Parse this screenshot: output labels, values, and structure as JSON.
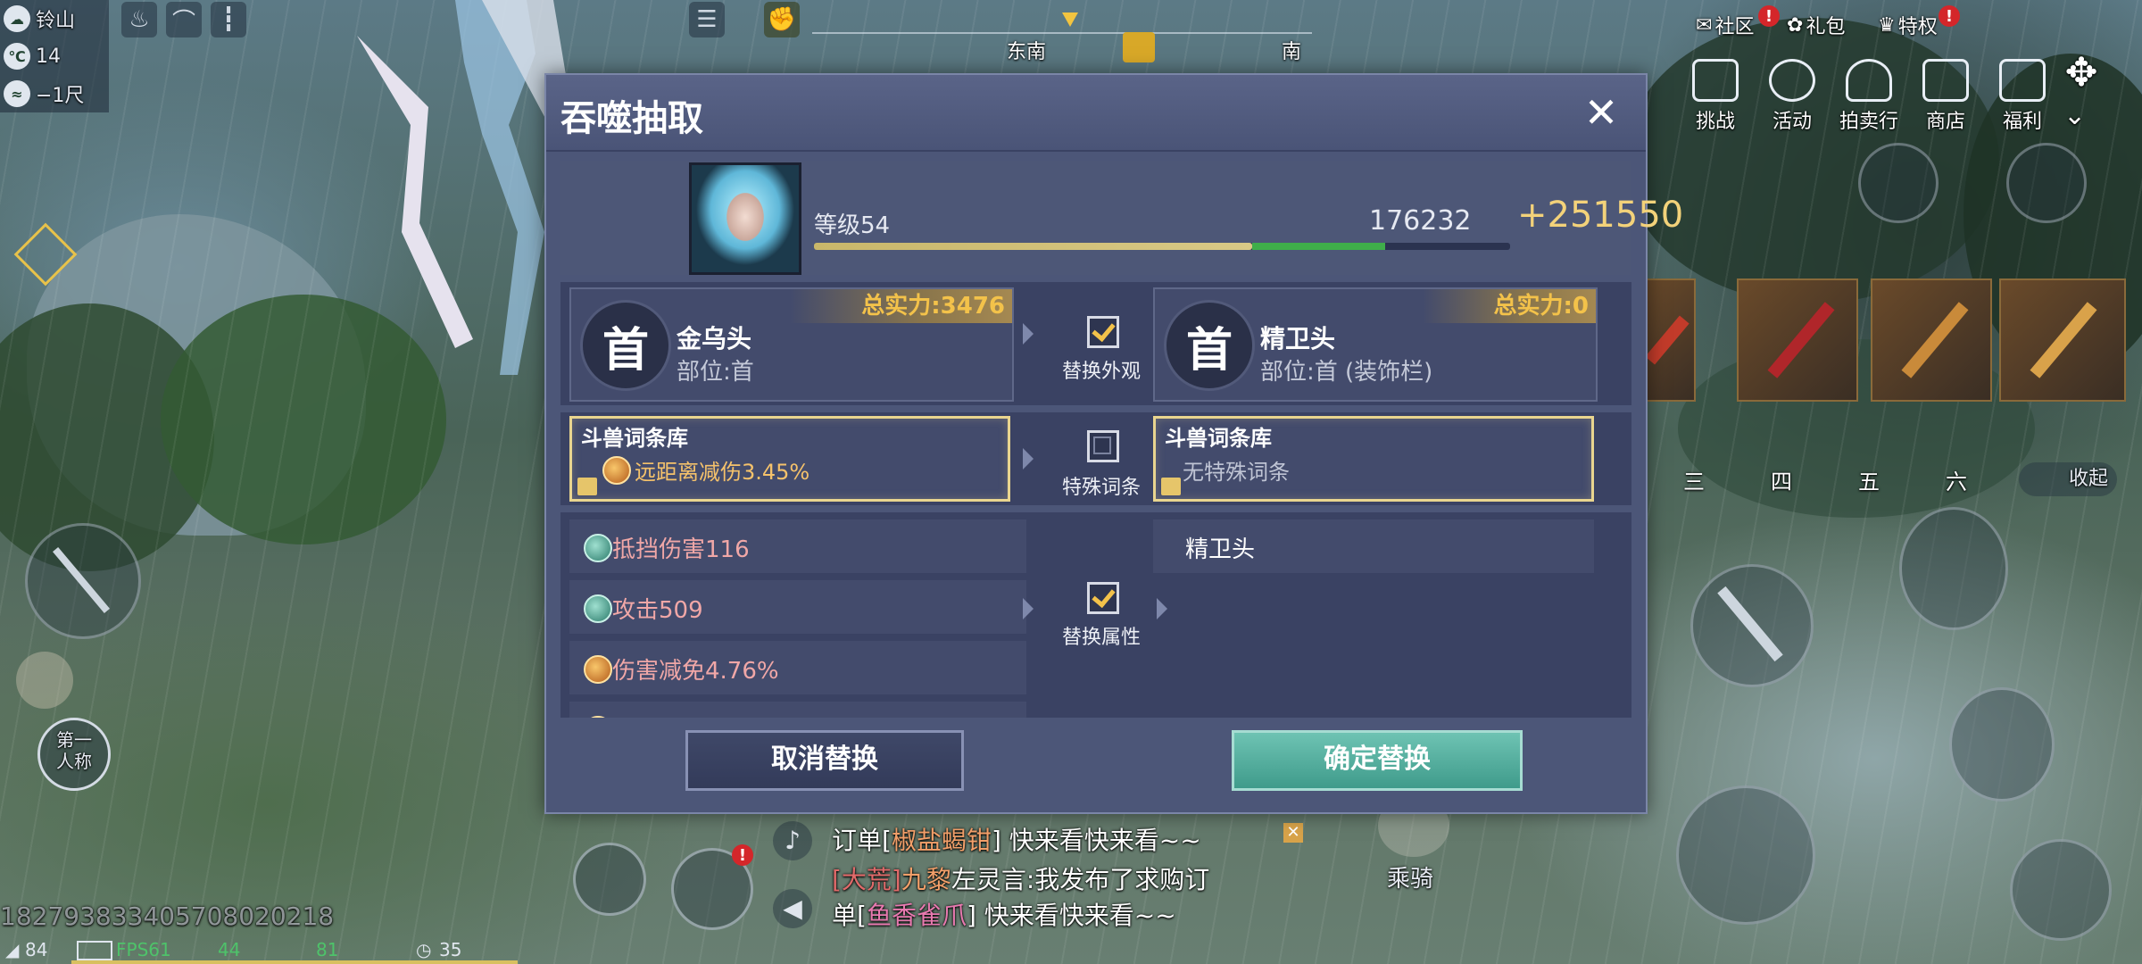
{
  "status": {
    "location": "铃山",
    "temperature": "14",
    "water_depth": "−1尺"
  },
  "compass": {
    "dir_left": "东南",
    "dir_right": "南"
  },
  "top_right": {
    "community": "社区",
    "gift": "礼包",
    "privilege": "特权",
    "badge": "!",
    "menu": [
      "挑战",
      "活动",
      "拍卖行",
      "商店",
      "福利"
    ]
  },
  "skill_bar_numbers": [
    "三",
    "四",
    "五",
    "六"
  ],
  "collapse_label": "收起",
  "dialog": {
    "title": "吞噬抽取",
    "level_label": "等级54",
    "exp_current": "176232",
    "exp_gain": "+251550",
    "exp_fill_fraction": 0.63,
    "exp_gain_fraction": 0.19,
    "left_item": {
      "power": "总实力:3476",
      "name": "金乌头",
      "part": "部位:首",
      "icon_glyph": "首"
    },
    "right_item": {
      "power": "总实力:0",
      "name": "精卫头",
      "part": "部位:首 (装饰栏)",
      "icon_glyph": "首"
    },
    "replace_appearance": {
      "label": "替换外观",
      "checked": true
    },
    "special_affix": {
      "label": "特殊词条",
      "checked": false
    },
    "replace_attr": {
      "label": "替换属性",
      "checked": true
    },
    "left_library": {
      "title": "斗兽词条库",
      "entry": "远距离减伤3.45%"
    },
    "right_library": {
      "title": "斗兽词条库",
      "entry": "无特殊词条"
    },
    "left_attrs": [
      "抵挡伤害116",
      "攻击509",
      "伤害减免4.76%"
    ],
    "right_attr_name": "精卫头",
    "cancel_button": "取消替换",
    "confirm_button": "确定替换"
  },
  "chat": {
    "line1_prefix": "订单[",
    "line1_item": "椒盐蝎钳",
    "line1_suffix": "] 快来看快来看~~",
    "line2_channel": "[大荒]",
    "line2_user": "九黎",
    "line2_text": "左灵言:我发布了求购订",
    "line3_prefix": "单[",
    "line3_item": "鱼香雀爪",
    "line3_suffix": "] 快来看快来看~~"
  },
  "mount_label": "乘骑",
  "first_person_label": "第一\n人称",
  "player_id": "18279383340570802021​8",
  "bottom": {
    "signal": "84",
    "fps": "FPS61",
    "ping_a": "44",
    "ping_b": "81",
    "time": "35"
  },
  "colors": {
    "panel": "#4c5678",
    "gold": "#f3c24a",
    "attr_red": "#f0a7a7",
    "confirm": "#5fb3a3"
  }
}
